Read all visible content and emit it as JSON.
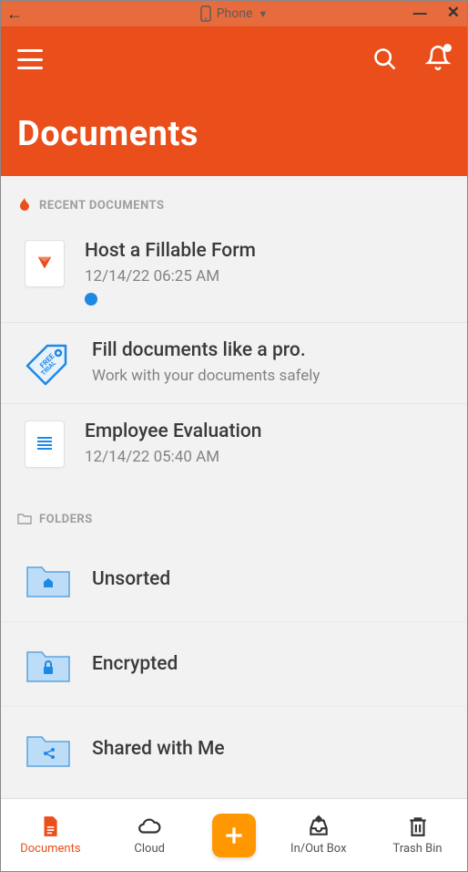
{
  "window": {
    "device_label": "Phone"
  },
  "header": {
    "title": "Documents"
  },
  "sections": {
    "recent_label": "RECENT DOCUMENTS",
    "folders_label": "FOLDERS"
  },
  "recent": [
    {
      "title": "Host a Fillable Form",
      "timestamp": "12/14/22 06:25 AM",
      "unread": true,
      "icon": "pdf"
    },
    {
      "title": "Fill documents like a pro.",
      "subtitle": "Work with your documents safely",
      "icon": "free-trial",
      "promo": true
    },
    {
      "title": "Employee Evaluation",
      "timestamp": "12/14/22 05:40 AM",
      "icon": "text"
    }
  ],
  "folders": [
    {
      "label": "Unsorted",
      "icon": "home"
    },
    {
      "label": "Encrypted",
      "icon": "lock"
    },
    {
      "label": "Shared with Me",
      "icon": "share"
    }
  ],
  "nav": {
    "documents": "Documents",
    "cloud": "Cloud",
    "inout": "In/Out Box",
    "trash": "Trash Bin"
  }
}
